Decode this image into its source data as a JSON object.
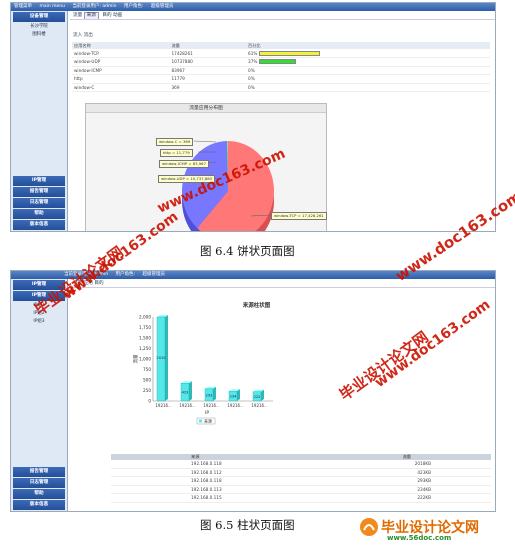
{
  "screens": {
    "pie": {
      "topbar": [
        "管理菜单",
        "main menu",
        "当前登录用户: admin",
        "用户角色:",
        "超级管理员"
      ],
      "nav_top": "设备管理",
      "nav_sub": [
        "长沙学院",
        "图科楼"
      ],
      "nav_bottom": [
        "IP管理",
        "报告管理",
        "日志管理",
        "帮助",
        "版本信息"
      ],
      "crumb": [
        "流量",
        "来源",
        "目的",
        "动画"
      ],
      "radio_row": "流入  流出",
      "table_headers": [
        "应用名称",
        "流量",
        "百分比"
      ],
      "rows": [
        {
          "name": "window-TCP",
          "flow": "17428261",
          "pct": "61%",
          "ratio": 0.61,
          "color": "#f1f13a"
        },
        {
          "name": "window-UDP",
          "flow": "10737880",
          "pct": "37%",
          "ratio": 0.37,
          "color": "#33dd33"
        },
        {
          "name": "window-ICMP",
          "flow": "83967",
          "pct": "0%",
          "ratio": 0,
          "color": "#ffffff"
        },
        {
          "name": "http",
          "flow": "11779",
          "pct": "0%",
          "ratio": 0,
          "color": "#ffffff"
        },
        {
          "name": "window-C",
          "flow": "369",
          "pct": "0%",
          "ratio": 0,
          "color": "#ffffff"
        }
      ],
      "panel_title": "流量应用分布图",
      "tips": [
        "window-C = 369",
        "http = 11,779",
        "window-ICMP = 83,967",
        "window-UDP = 10,737,880",
        "window-TCP = 17,428,261"
      ]
    },
    "bar": {
      "topbar": [
        "当前登录用户: admin",
        "用户角色:",
        "超级管理员"
      ],
      "nav_top": [
        "IP管理",
        "IP管理"
      ],
      "nav_sub": [
        "IP组1",
        "IP组2",
        "IP组3"
      ],
      "nav_bottom": [
        "报告管理",
        "日志管理",
        "帮助",
        "版本信息"
      ],
      "crumb": [
        "流量",
        "应用",
        "目的"
      ],
      "table_headers": [
        "来源",
        "流量"
      ],
      "rows": [
        {
          "ip": "192.168.0.118",
          "flow": "2018KB"
        },
        {
          "ip": "192.168.0.112",
          "flow": "423KB"
        },
        {
          "ip": "192.168.0.118",
          "flow": "293KB"
        },
        {
          "ip": "192.168.0.113",
          "flow": "234KB"
        },
        {
          "ip": "192.168.0.115",
          "flow": "222KB"
        }
      ]
    }
  },
  "captions": [
    "图 6.4 饼状页面图",
    "图 6.5 柱状页面图"
  ],
  "watermarks": [
    "毕业设计论文网",
    "www.doc163.com"
  ],
  "footer": {
    "title": "毕业设计论文网",
    "url": "www.56doc.com"
  },
  "chart_data": [
    {
      "type": "pie",
      "title": "流量应用分布图",
      "labels": [
        "window-TCP",
        "window-UDP",
        "window-ICMP",
        "http",
        "window-C"
      ],
      "values": [
        17428261,
        10737880,
        83967,
        11779,
        369
      ],
      "colors": [
        "#ff7777",
        "#7777ff",
        "#77dd77",
        "#dddd55",
        "#55dddd"
      ]
    },
    {
      "type": "bar",
      "title": "来源柱状图",
      "categories": [
        "19216..",
        "19216..",
        "19216..",
        "19216..",
        "19216.."
      ],
      "values": [
        2010,
        423,
        293,
        234,
        222
      ],
      "data_labels": [
        "2010",
        "423",
        "293",
        "234",
        "222"
      ],
      "ylabel": "流量",
      "xlabel": "IP",
      "ylim": [
        0,
        2000
      ],
      "yticks": [
        "0",
        "250",
        "500",
        "750",
        "1,000",
        "1,250",
        "1,500",
        "1,750",
        "2,000"
      ],
      "legend": "来源",
      "color": "#55e8e8"
    }
  ]
}
